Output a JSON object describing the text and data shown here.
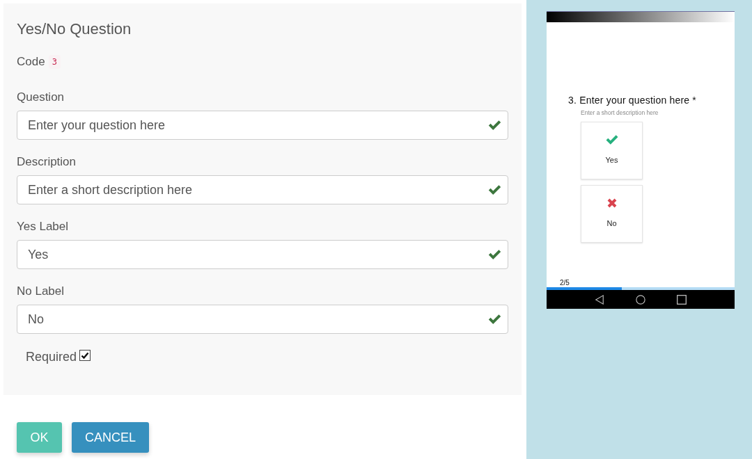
{
  "editor": {
    "title": "Yes/No Question",
    "code": {
      "label": "Code",
      "value": "3"
    },
    "fields": [
      {
        "label": "Question",
        "value": "Enter your question here",
        "valid": true
      },
      {
        "label": "Description",
        "value": "Enter a short description here",
        "valid": true
      },
      {
        "label": "Yes Label",
        "value": "Yes",
        "valid": true
      },
      {
        "label": "No Label",
        "value": "No",
        "valid": true
      }
    ],
    "required": {
      "label": "Required",
      "checked": true
    }
  },
  "buttons": [
    {
      "label": "OK",
      "kind": "ok"
    },
    {
      "label": "CANCEL",
      "kind": "cancel"
    }
  ],
  "preview": {
    "question": "3. Enter your question here *",
    "description": "Enter a short description here",
    "options": [
      {
        "label": "Yes",
        "kind": "yes"
      },
      {
        "label": "No",
        "kind": "no"
      }
    ],
    "page": "2/5",
    "progress": {
      "level": 0.4
    }
  }
}
